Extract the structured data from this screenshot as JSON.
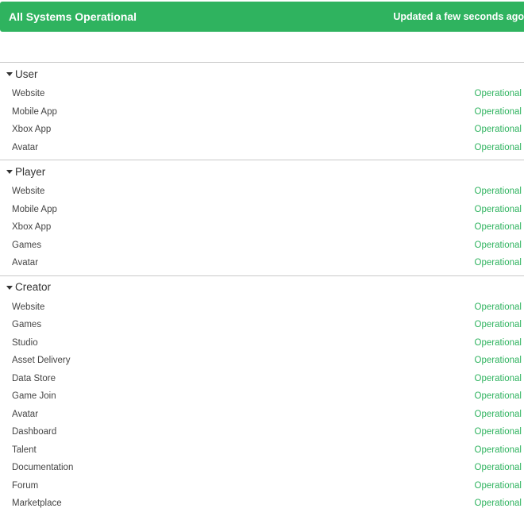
{
  "banner": {
    "title": "All Systems Operational",
    "updated": "Updated a few seconds ago",
    "color": "#2fb35f"
  },
  "colors": {
    "operational": "#2fb35f"
  },
  "groups": [
    {
      "name": "User",
      "components": [
        {
          "name": "Website",
          "status": "Operational"
        },
        {
          "name": "Mobile App",
          "status": "Operational"
        },
        {
          "name": "Xbox App",
          "status": "Operational"
        },
        {
          "name": "Avatar",
          "status": "Operational"
        }
      ]
    },
    {
      "name": "Player",
      "components": [
        {
          "name": "Website",
          "status": "Operational"
        },
        {
          "name": "Mobile App",
          "status": "Operational"
        },
        {
          "name": "Xbox App",
          "status": "Operational"
        },
        {
          "name": "Games",
          "status": "Operational"
        },
        {
          "name": "Avatar",
          "status": "Operational"
        }
      ]
    },
    {
      "name": "Creator",
      "components": [
        {
          "name": "Website",
          "status": "Operational"
        },
        {
          "name": "Games",
          "status": "Operational"
        },
        {
          "name": "Studio",
          "status": "Operational"
        },
        {
          "name": "Asset Delivery",
          "status": "Operational"
        },
        {
          "name": "Data Store",
          "status": "Operational"
        },
        {
          "name": "Game Join",
          "status": "Operational"
        },
        {
          "name": "Avatar",
          "status": "Operational"
        },
        {
          "name": "Dashboard",
          "status": "Operational"
        },
        {
          "name": "Talent",
          "status": "Operational"
        },
        {
          "name": "Documentation",
          "status": "Operational"
        },
        {
          "name": "Forum",
          "status": "Operational"
        },
        {
          "name": "Marketplace",
          "status": "Operational"
        }
      ]
    }
  ]
}
